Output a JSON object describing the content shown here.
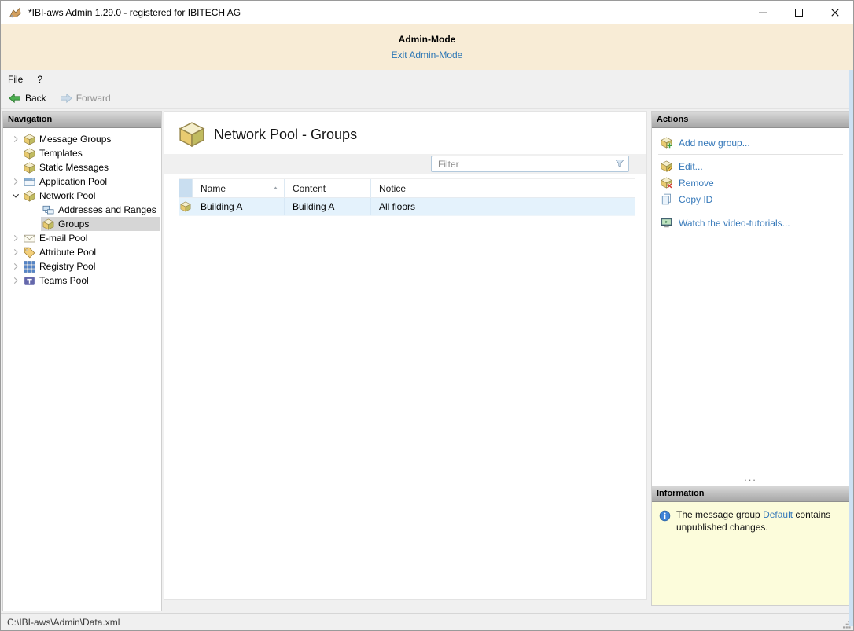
{
  "window": {
    "title": "*IBI-aws Admin 1.29.0 - registered for IBITECH AG"
  },
  "admin_banner": {
    "title": "Admin-Mode",
    "exit_link": "Exit Admin-Mode"
  },
  "menu": {
    "items": [
      {
        "label": "File"
      },
      {
        "label": "?"
      }
    ]
  },
  "toolbar": {
    "back_label": "Back",
    "forward_label": "Forward"
  },
  "navigation": {
    "header": "Navigation",
    "items": [
      {
        "label": "Message Groups",
        "icon": "cube-icon",
        "expander": "collapsed",
        "level": 0,
        "selected": false
      },
      {
        "label": "Templates",
        "icon": "cube-icon",
        "expander": "none",
        "level": 0,
        "selected": false
      },
      {
        "label": "Static Messages",
        "icon": "cube-icon",
        "expander": "none",
        "level": 0,
        "selected": false
      },
      {
        "label": "Application Pool",
        "icon": "window-icon",
        "expander": "collapsed",
        "level": 0,
        "selected": false
      },
      {
        "label": "Network Pool",
        "icon": "cube-icon",
        "expander": "expanded",
        "level": 0,
        "selected": false
      },
      {
        "label": "Addresses and Ranges",
        "icon": "network-icon",
        "expander": "none",
        "level": 1,
        "selected": false
      },
      {
        "label": "Groups",
        "icon": "cube-icon",
        "expander": "none",
        "level": 1,
        "selected": true
      },
      {
        "label": "E-mail Pool",
        "icon": "mail-icon",
        "expander": "collapsed",
        "level": 0,
        "selected": false
      },
      {
        "label": "Attribute Pool",
        "icon": "tag-icon",
        "expander": "collapsed",
        "level": 0,
        "selected": false
      },
      {
        "label": "Registry Pool",
        "icon": "grid-icon",
        "expander": "collapsed",
        "level": 0,
        "selected": false
      },
      {
        "label": "Teams Pool",
        "icon": "teams-icon",
        "expander": "collapsed",
        "level": 0,
        "selected": false
      }
    ]
  },
  "content": {
    "title": "Network Pool - Groups",
    "title_icon": "cube-icon",
    "filter": {
      "placeholder": "Filter",
      "icon": "funnel-icon"
    },
    "table": {
      "columns": [
        {
          "label": "Name",
          "sorted": "asc"
        },
        {
          "label": "Content",
          "sorted": null
        },
        {
          "label": "Notice",
          "sorted": null
        }
      ],
      "rows": [
        {
          "icon": "cube-icon",
          "name": "Building A",
          "content": "Building A",
          "notice": "All floors"
        }
      ]
    }
  },
  "actions": {
    "header": "Actions",
    "items": [
      {
        "label": "Add new group...",
        "icon": "cube-add-icon",
        "separator_after": true
      },
      {
        "label": "Edit...",
        "icon": "cube-edit-icon",
        "separator_after": false
      },
      {
        "label": "Remove",
        "icon": "cube-remove-icon",
        "separator_after": false
      },
      {
        "label": "Copy ID",
        "icon": "copy-icon",
        "separator_after": true
      },
      {
        "label": "Watch the video-tutorials...",
        "icon": "video-icon",
        "separator_after": false
      }
    ],
    "overflow": "..."
  },
  "information": {
    "header": "Information",
    "icon": "info-icon",
    "text_before": "The message group ",
    "link_label": "Default",
    "text_after": " contains unpublished changes."
  },
  "status_bar": {
    "path": "C:\\IBI-aws\\Admin\\Data.xml"
  },
  "theme": {
    "link_color": "#3578b9",
    "banner_bg": "#f8ecd6",
    "selection_bg": "#d6d6d6",
    "table_row_bg": "#e4f2fc",
    "info_bg": "#fcfcdb"
  }
}
